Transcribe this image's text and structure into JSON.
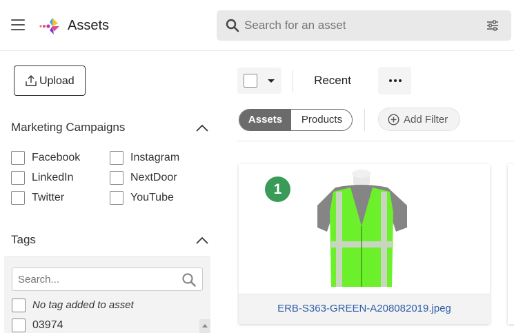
{
  "header": {
    "app_title": "Assets",
    "search_placeholder": "Search for an asset"
  },
  "sidebar": {
    "upload_label": "Upload",
    "campaigns": {
      "title": "Marketing Campaigns",
      "items": [
        {
          "label": "Facebook",
          "checked": false
        },
        {
          "label": "Instagram",
          "checked": false
        },
        {
          "label": "LinkedIn",
          "checked": false
        },
        {
          "label": "NextDoor",
          "checked": false
        },
        {
          "label": "Twitter",
          "checked": false
        },
        {
          "label": "YouTube",
          "checked": false
        }
      ]
    },
    "tags": {
      "title": "Tags",
      "search_placeholder": "Search...",
      "items": [
        {
          "label": "No tag added to asset",
          "checked": false
        },
        {
          "label": "03974",
          "checked": false
        }
      ]
    }
  },
  "toolbar": {
    "sort_label": "Recent",
    "segments": [
      "Assets",
      "Products"
    ],
    "active_segment": "Assets",
    "add_filter_label": "Add Filter"
  },
  "assets": [
    {
      "badge": "1",
      "filename": "ERB-S363-GREEN-A208082019.jpeg"
    }
  ],
  "colors": {
    "badge_green": "#3a9a58",
    "link_blue": "#2f5ea8",
    "vest_green": "#6cf02c",
    "segment_active": "#6b6b6b"
  }
}
